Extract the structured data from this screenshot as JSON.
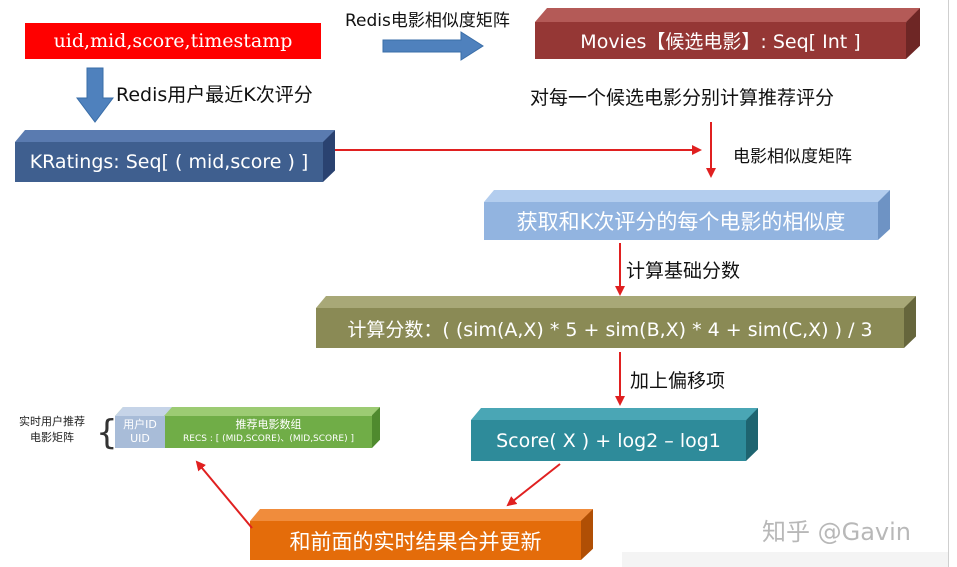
{
  "input_box": {
    "text": "uid,mid,score,timestamp"
  },
  "movies_box": {
    "text": "Movies【候选电影】: Seq[ Int ]"
  },
  "kratings_box": {
    "text": "KRatings: Seq[ ( mid,score ) ]"
  },
  "similarity_box": {
    "text": "获取和K次评分的每个电影的相似度"
  },
  "formula_box": {
    "text": "计算分数：( (sim(A,X) * 5 + sim(B,X) * 4 + sim(C,X) ) / 3"
  },
  "score_box": {
    "text": "Score( X ) + log2 – log1"
  },
  "merge_box": {
    "text": "和前面的实时结果合并更新"
  },
  "labels": {
    "redis_movie_sim_top": "Redis电影相似度矩阵",
    "redis_user_recent": "Redis用户最近K次评分",
    "per_candidate": "对每一个候选电影分别计算推荐评分",
    "movie_sim_matrix": "电影相似度矩阵",
    "compute_base": "计算基础分数",
    "add_offset": "加上偏移项"
  },
  "legend": {
    "title_line1": "实时用户推荐",
    "title_line2": "电影矩阵",
    "user_col_line1": "用户ID",
    "user_col_line2": "UID",
    "recs_col_line1": "推荐电影数组",
    "recs_col_line2": "RECS : [ (MID,SCORE)、(MID,SCORE) ]"
  },
  "watermark": {
    "text": "知乎 @Gavin"
  },
  "colors": {
    "input_red": "#ff0000",
    "movies": "#953735",
    "kratings": "#3f5f8f",
    "similarity": "#92b4e0",
    "formula": "#8a8a55",
    "score": "#2e8b9a",
    "merge": "#e46c0a",
    "blue_arrow": "#4f81bd",
    "red_line": "#e02020"
  }
}
